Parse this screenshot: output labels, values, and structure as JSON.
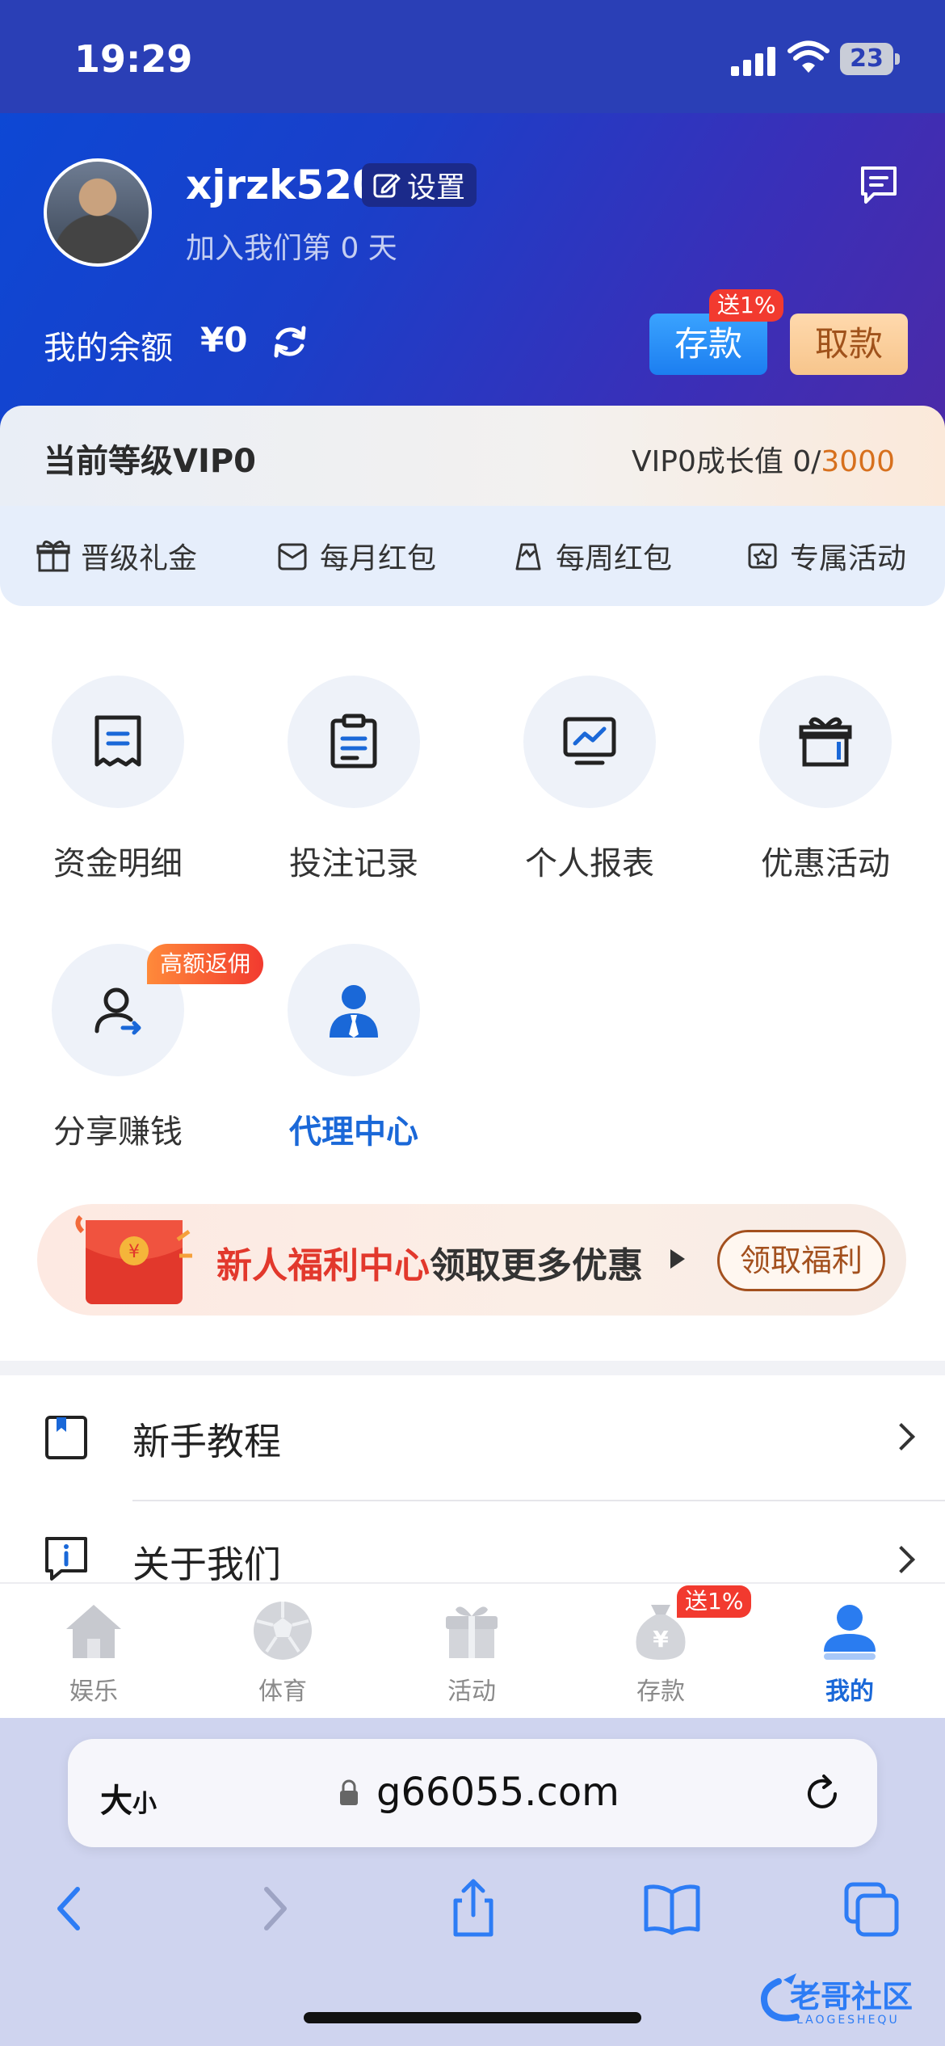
{
  "status_bar": {
    "time": "19:29",
    "battery": "23"
  },
  "profile": {
    "username": "xjrzk520",
    "settings_label": "设置",
    "joined_text": "加入我们第 0 天"
  },
  "balance": {
    "label": "我的余额",
    "value": "¥0",
    "deposit_label": "存款",
    "deposit_badge": "送1%",
    "withdraw_label": "取款"
  },
  "vip": {
    "current_level": "当前等级VIP0",
    "growth_prefix": "VIP0成长值 0/",
    "growth_target": "3000",
    "perks": [
      "晋级礼金",
      "每月红包",
      "每周红包",
      "专属活动"
    ]
  },
  "grid": {
    "items": [
      {
        "label": "资金明细",
        "icon": "receipt-icon"
      },
      {
        "label": "投注记录",
        "icon": "clipboard-icon"
      },
      {
        "label": "个人报表",
        "icon": "monitor-chart-icon"
      },
      {
        "label": "优惠活动",
        "icon": "gift-box-icon"
      },
      {
        "label": "分享赚钱",
        "icon": "user-share-icon",
        "badge": "高额返佣"
      },
      {
        "label": "代理中心",
        "icon": "agent-icon"
      }
    ]
  },
  "promo": {
    "highlight": "新人福利中心",
    "text": "领取更多优惠",
    "button": "领取福利"
  },
  "menu": {
    "items": [
      {
        "label": "新手教程",
        "icon": "book-icon"
      },
      {
        "label": "关于我们",
        "icon": "info-icon"
      }
    ]
  },
  "tabbar": {
    "items": [
      {
        "label": "娱乐",
        "icon": "home-icon",
        "active": false
      },
      {
        "label": "体育",
        "icon": "soccer-ball-icon",
        "active": false
      },
      {
        "label": "活动",
        "icon": "gift-icon",
        "active": false
      },
      {
        "label": "存款",
        "icon": "money-bag-icon",
        "active": false,
        "badge": "送1%"
      },
      {
        "label": "我的",
        "icon": "person-icon",
        "active": true
      }
    ]
  },
  "browser": {
    "text_size_label": "大",
    "text_size_small": "小",
    "url": "g66055.com"
  },
  "watermark": {
    "title": "老哥社区",
    "subtitle": "LAOGESHEQU"
  },
  "colors": {
    "brand_blue": "#1a68d8",
    "header_start": "#0b49d6",
    "header_end": "#4b2aa8",
    "accent_orange": "#d7701d",
    "badge_red": "#f23a2f"
  }
}
